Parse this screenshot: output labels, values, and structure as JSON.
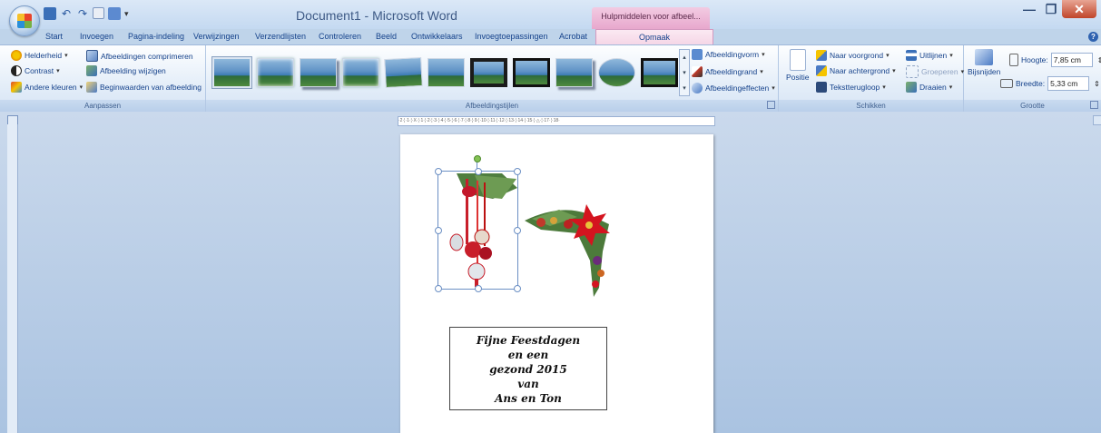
{
  "window": {
    "title": "Document1 - Microsoft Word",
    "context_title": "Hulpmiddelen voor afbeel...",
    "minimize": "—",
    "maximize": "❐",
    "close": "✕"
  },
  "quick_access": {
    "undo": "↶",
    "redo": "↷",
    "dropdown": "▾"
  },
  "tabs": [
    "Start",
    "Invoegen",
    "Pagina-indeling",
    "Verwijzingen",
    "Verzendlijsten",
    "Controleren",
    "Beeld",
    "Ontwikkelaars",
    "Invoegtoepassingen",
    "Acrobat"
  ],
  "context_tab": "Opmaak",
  "help": "?",
  "ribbon": {
    "aanpassen": {
      "label": "Aanpassen",
      "helderheid": "Helderheid",
      "contrast": "Contrast",
      "andere_kleuren": "Andere kleuren",
      "comprimeren": "Afbeeldingen comprimeren",
      "wijzigen": "Afbeelding wijzigen",
      "beginwaarden": "Beginwaarden van afbeelding"
    },
    "stijlen": {
      "label": "Afbeeldingstijlen",
      "vorm": "Afbeeldingvorm",
      "rand": "Afbeeldingrand",
      "effecten": "Afbeeldingeffecten"
    },
    "schikken": {
      "label": "Schikken",
      "positie": "Positie",
      "voorgrond": "Naar voorgrond",
      "achtergrond": "Naar achtergrond",
      "tekstterugloop": "Tekstterugloop",
      "uitlijnen": "Uitlijnen",
      "groeperen": "Groeperen",
      "draaien": "Draaien"
    },
    "grootte": {
      "label": "Grootte",
      "bijsnijden": "Bijsnijden",
      "hoogte_label": "Hoogte:",
      "hoogte": "7,85 cm",
      "breedte_label": "Breedte:",
      "breedte": "5,33 cm"
    }
  },
  "ruler": {
    "ticks": "·2·¦·1·¦·X·¦·1·¦·2·¦·3·¦·4·¦·5·¦·6·¦·7·¦·8·¦·9·¦·10·¦·11·¦·12·¦·13·¦·14·¦·15·¦·△·¦·17·¦·18·"
  },
  "greeting": [
    "Fijne Feestdagen",
    "en een",
    "gezond 2015",
    "van",
    "Ans en Ton"
  ],
  "colors": {
    "ribbon_bg": "#dfe9f6",
    "context_tab": "#f0c0dc",
    "close_btn": "#c0452a",
    "selection": "#6b8fc4"
  }
}
